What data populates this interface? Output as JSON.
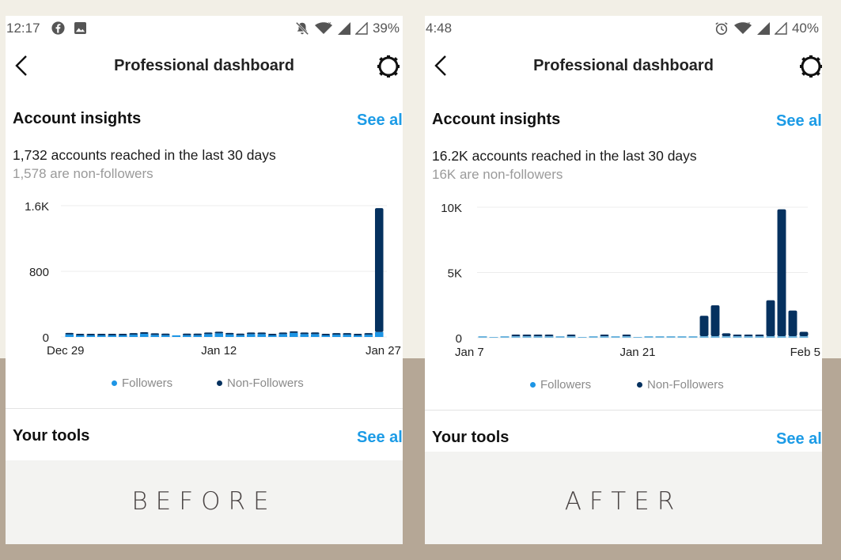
{
  "panels": [
    {
      "id": "before",
      "status_bar": {
        "time": "12:17",
        "left_icons": [
          "facebook-icon",
          "image-icon"
        ],
        "right_icons": [
          "bell-off-icon",
          "wifi-icon",
          "signal-icon",
          "signal-empty-icon"
        ],
        "battery": "39%"
      },
      "nav": {
        "title": "Professional dashboard",
        "back_icon": "chevron-left-icon",
        "settings_icon": "gear-icon"
      },
      "insights": {
        "title": "Account insights",
        "see_all": "See all",
        "reach": "1,732 accounts reached in the last 30 days",
        "non_followers": "1,578 are non-followers"
      },
      "legend": {
        "followers": "Followers",
        "non_followers": "Non-Followers"
      },
      "tools": {
        "title": "Your tools",
        "see_all": "See all"
      },
      "caption": "BEFORE"
    },
    {
      "id": "after",
      "status_bar": {
        "time": "4:48",
        "left_icons": [],
        "right_icons": [
          "alarm-icon",
          "wifi-icon",
          "signal-icon",
          "signal-empty-icon"
        ],
        "battery": "40%"
      },
      "nav": {
        "title": "Professional dashboard",
        "back_icon": "chevron-left-icon",
        "settings_icon": "gear-icon"
      },
      "insights": {
        "title": "Account insights",
        "see_all": "See all",
        "reach": "16.2K accounts reached in the last 30 days",
        "non_followers": "16K are non-followers"
      },
      "legend": {
        "followers": "Followers",
        "non_followers": "Non-Followers"
      },
      "tools": {
        "title": "Your tools",
        "see_all": "See all"
      },
      "caption": "AFTER"
    }
  ],
  "colors": {
    "followers": "#1d95e5",
    "non_followers": "#05315f",
    "link": "#1c9be6",
    "background_top": "#f2efe6",
    "background_bottom": "#b5a796"
  },
  "chart_data": [
    {
      "type": "bar",
      "stacked": true,
      "title": "",
      "xlabel": "",
      "ylabel": "",
      "x_tick_labels": [
        "Dec 29",
        "Jan 12",
        "Jan 27"
      ],
      "x_tick_indices": [
        0,
        14,
        29
      ],
      "y_ticks": [
        0,
        800,
        1600
      ],
      "y_tick_labels": [
        "0",
        "800",
        "1.6K"
      ],
      "ylim": [
        0,
        1600
      ],
      "grid": true,
      "legend": "bottom",
      "categories": [
        "Dec 29",
        "Dec 30",
        "Dec 31",
        "Jan 1",
        "Jan 2",
        "Jan 3",
        "Jan 4",
        "Jan 5",
        "Jan 6",
        "Jan 7",
        "Jan 8",
        "Jan 9",
        "Jan 10",
        "Jan 11",
        "Jan 12",
        "Jan 13",
        "Jan 14",
        "Jan 15",
        "Jan 16",
        "Jan 17",
        "Jan 18",
        "Jan 19",
        "Jan 20",
        "Jan 21",
        "Jan 22",
        "Jan 23",
        "Jan 24",
        "Jan 25",
        "Jan 26",
        "Jan 27"
      ],
      "series": [
        {
          "name": "Followers",
          "values": [
            30,
            5,
            8,
            8,
            8,
            18,
            28,
            38,
            25,
            22,
            3,
            22,
            22,
            35,
            45,
            30,
            22,
            35,
            35,
            8,
            35,
            50,
            35,
            35,
            8,
            28,
            28,
            15,
            28,
            60
          ]
        },
        {
          "name": "Non-Followers",
          "values": [
            2,
            5,
            2,
            2,
            2,
            2,
            2,
            5,
            2,
            2,
            0,
            2,
            5,
            2,
            8,
            10,
            2,
            2,
            8,
            2,
            2,
            5,
            15,
            20,
            5,
            2,
            5,
            2,
            2,
            1510
          ]
        }
      ]
    },
    {
      "type": "bar",
      "stacked": true,
      "title": "",
      "xlabel": "",
      "ylabel": "",
      "x_tick_labels": [
        "Jan 7",
        "Jan 21",
        "Feb 5"
      ],
      "x_tick_indices": [
        0,
        14,
        29
      ],
      "y_ticks": [
        0,
        5000,
        10000
      ],
      "y_tick_labels": [
        "0",
        "5K",
        "10K"
      ],
      "ylim": [
        0,
        10000
      ],
      "grid": true,
      "legend": "bottom",
      "categories": [
        "Jan 7",
        "Jan 8",
        "Jan 9",
        "Jan 10",
        "Jan 11",
        "Jan 12",
        "Jan 13",
        "Jan 14",
        "Jan 15",
        "Jan 16",
        "Jan 17",
        "Jan 18",
        "Jan 19",
        "Jan 20",
        "Jan 21",
        "Jan 22",
        "Jan 23",
        "Jan 24",
        "Jan 25",
        "Jan 26",
        "Jan 27",
        "Jan 28",
        "Jan 29",
        "Jan 30",
        "Jan 31",
        "Feb 1",
        "Feb 2",
        "Feb 3",
        "Feb 4",
        "Feb 5"
      ],
      "series": [
        {
          "name": "Followers",
          "values": [
            20,
            0,
            20,
            20,
            30,
            20,
            20,
            20,
            20,
            0,
            30,
            30,
            20,
            30,
            0,
            20,
            20,
            20,
            20,
            20,
            40,
            40,
            20,
            20,
            20,
            20,
            60,
            80,
            60,
            30
          ]
        },
        {
          "name": "Non-Followers",
          "values": [
            0,
            0,
            0,
            60,
            20,
            10,
            20,
            0,
            30,
            0,
            0,
            30,
            0,
            20,
            0,
            0,
            0,
            0,
            0,
            0,
            1560,
            2360,
            220,
            20,
            20,
            20,
            2750,
            9720,
            1960,
            330
          ]
        }
      ]
    }
  ]
}
